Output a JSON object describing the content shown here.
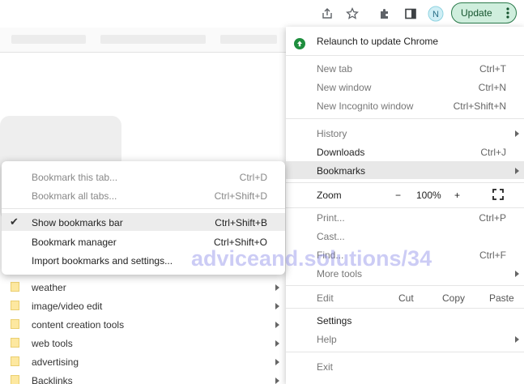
{
  "toolbar": {
    "update_label": "Update",
    "profile_initial": "N",
    "icons": [
      "share-icon",
      "star-icon",
      "puzzle-icon",
      "sidepanel-icon",
      "profile-avatar",
      "kebab-icon"
    ]
  },
  "menu": {
    "relaunch": "Relaunch to update Chrome",
    "new_tab": {
      "label": "New tab",
      "shortcut": "Ctrl+T"
    },
    "new_window": {
      "label": "New window",
      "shortcut": "Ctrl+N"
    },
    "new_incognito": {
      "label": "New Incognito window",
      "shortcut": "Ctrl+Shift+N"
    },
    "history": {
      "label": "History"
    },
    "downloads": {
      "label": "Downloads",
      "shortcut": "Ctrl+J"
    },
    "bookmarks": {
      "label": "Bookmarks"
    },
    "zoom": {
      "label": "Zoom",
      "minus": "−",
      "value": "100%",
      "plus": "+"
    },
    "print": {
      "label": "Print...",
      "shortcut": "Ctrl+P"
    },
    "cast": {
      "label": "Cast..."
    },
    "find": {
      "label": "Find...",
      "shortcut": "Ctrl+F"
    },
    "more_tools": {
      "label": "More tools"
    },
    "edit": {
      "label": "Edit",
      "cut": "Cut",
      "copy": "Copy",
      "paste": "Paste"
    },
    "settings": {
      "label": "Settings"
    },
    "help": {
      "label": "Help"
    },
    "exit": {
      "label": "Exit"
    }
  },
  "bookmarks_submenu": {
    "bookmark_tab": {
      "label": "Bookmark this tab...",
      "shortcut": "Ctrl+D"
    },
    "bookmark_all": {
      "label": "Bookmark all tabs...",
      "shortcut": "Ctrl+Shift+D"
    },
    "show_bar": {
      "label": "Show bookmarks bar",
      "shortcut": "Ctrl+Shift+B",
      "checked": true
    },
    "manager": {
      "label": "Bookmark manager",
      "shortcut": "Ctrl+Shift+O"
    },
    "import": {
      "label": "Import bookmarks and settings..."
    },
    "folders": [
      "weather",
      "image/video edit",
      "content creation tools",
      "web tools",
      "advertising",
      "Backlinks"
    ]
  },
  "watermark": "adviceand.solutions/34",
  "colors": {
    "update_bg": "#cfeedd",
    "update_border": "#2b7a4b",
    "relaunch_green": "#1e8e3e",
    "folder": "#fde8a0"
  }
}
